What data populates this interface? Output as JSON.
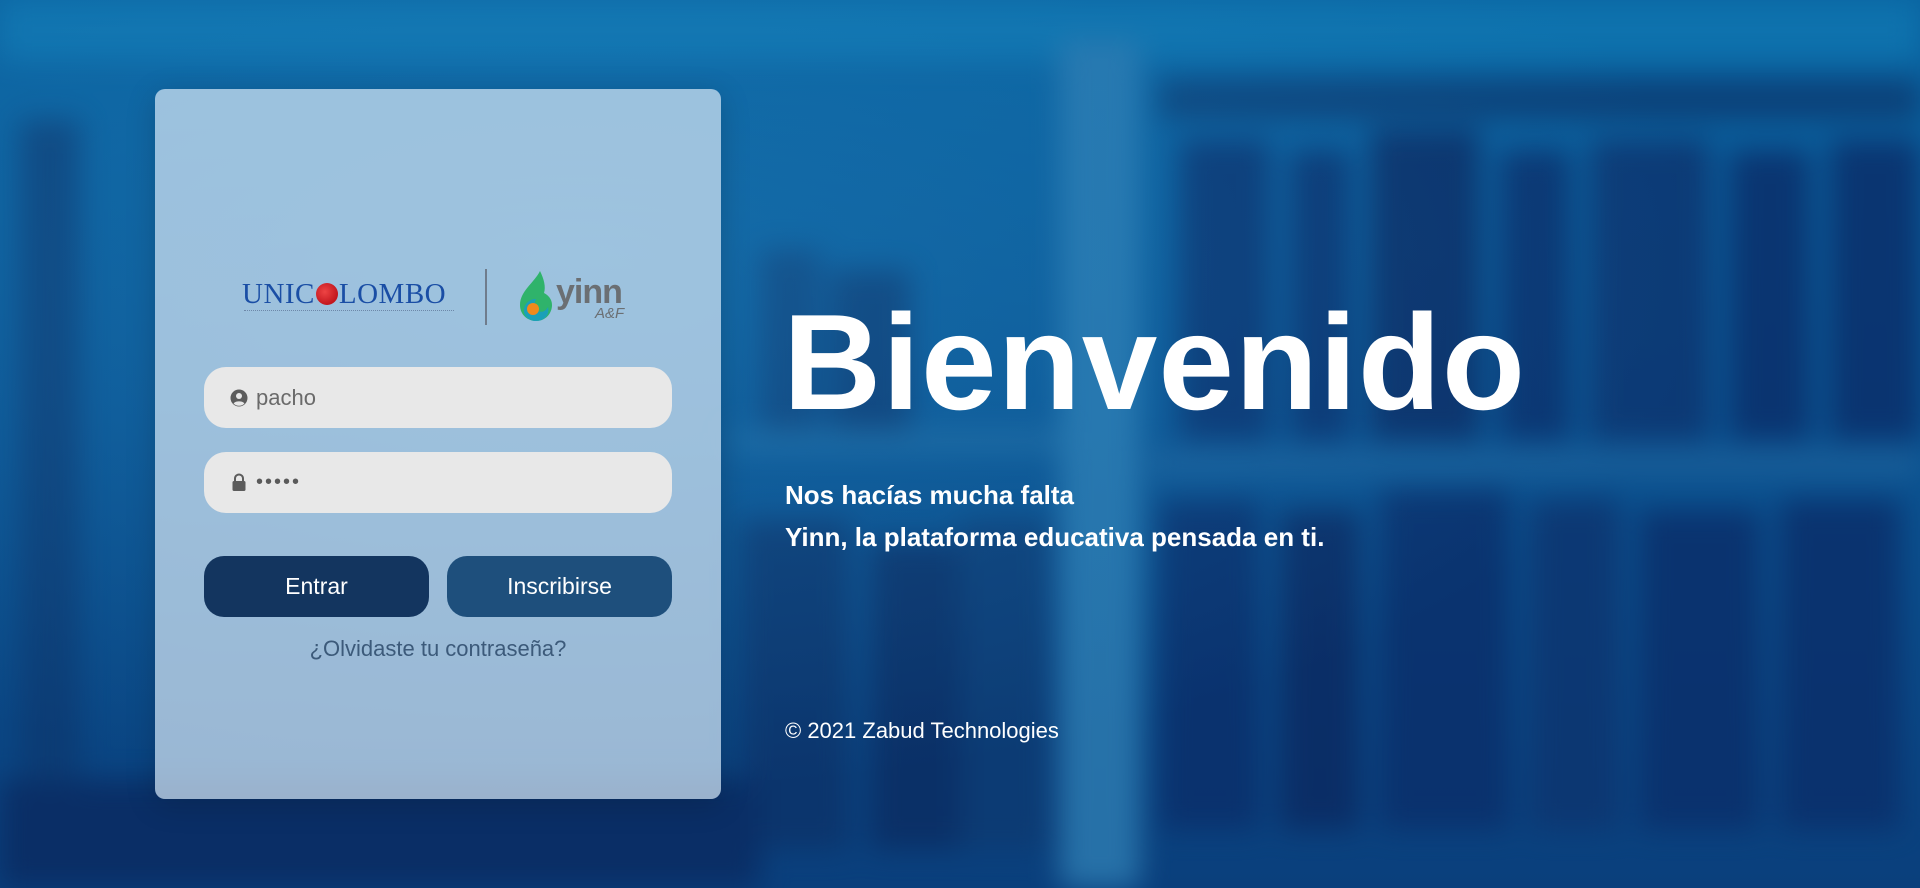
{
  "login": {
    "logos": {
      "unicolombo": {
        "before_globe": "UNIC",
        "after_globe": "LOMBO"
      },
      "yinn": {
        "word": "yinn",
        "tagline": "A&F"
      }
    },
    "username": {
      "value": "pacho",
      "icon": "user-circle-icon"
    },
    "password": {
      "value": "•••••",
      "icon": "lock-icon"
    },
    "buttons": {
      "enter": "Entrar",
      "signup": "Inscribirse"
    },
    "forgot": "¿Olvidaste tu contraseña?"
  },
  "welcome": {
    "headline": "Bienvenido",
    "line1": "Nos hacías mucha falta",
    "line2": "Yinn, la plataforma educativa pensada en ti.",
    "copyright": "© 2021 Zabud Technologies"
  },
  "colors": {
    "enter_button": "#13355f",
    "signup_button": "#1e4f7c",
    "background": "#0b5593"
  }
}
